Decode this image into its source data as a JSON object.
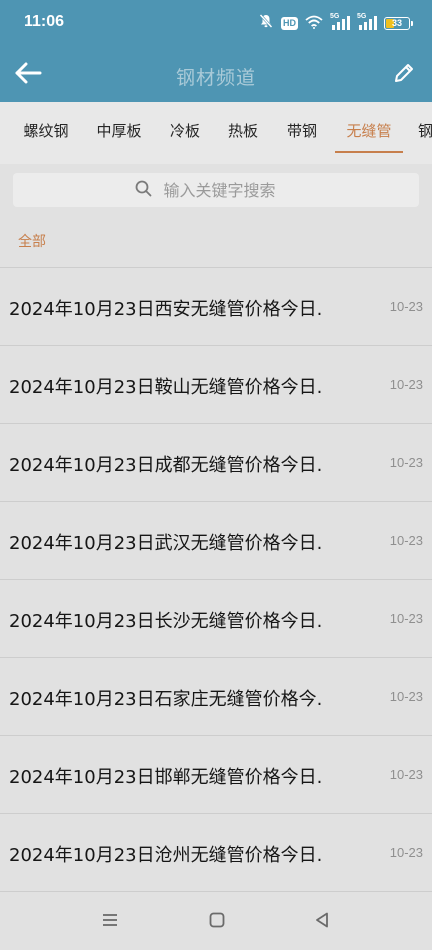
{
  "status_bar": {
    "time": "11:06",
    "hd_label": "HD",
    "battery_level": "33",
    "battery_fraction": 0.33,
    "icons": [
      "mute-bell-icon",
      "hd-icon",
      "wifi-icon",
      "5g-signal-icon",
      "5g-signal-icon",
      "battery-icon"
    ],
    "network_labels": [
      "5G",
      "5G"
    ]
  },
  "header": {
    "title": "钢材频道",
    "back_icon": "arrow-left-icon",
    "edit_icon": "pencil-icon"
  },
  "tabs": [
    {
      "label": "螺纹钢",
      "active": false
    },
    {
      "label": "中厚板",
      "active": false
    },
    {
      "label": "冷板",
      "active": false
    },
    {
      "label": "热板",
      "active": false
    },
    {
      "label": "带钢",
      "active": false
    },
    {
      "label": "无缝管",
      "active": true
    },
    {
      "label": "钢",
      "active": false
    }
  ],
  "search": {
    "placeholder": "输入关键字搜索",
    "icon": "search-icon"
  },
  "filter": {
    "label": "全部"
  },
  "news": [
    {
      "title": "2024年10月23日西安无缝管价格今日.",
      "date": "10-23"
    },
    {
      "title": "2024年10月23日鞍山无缝管价格今日.",
      "date": "10-23"
    },
    {
      "title": "2024年10月23日成都无缝管价格今日.",
      "date": "10-23"
    },
    {
      "title": "2024年10月23日武汉无缝管价格今日.",
      "date": "10-23"
    },
    {
      "title": "2024年10月23日长沙无缝管价格今日.",
      "date": "10-23"
    },
    {
      "title": "2024年10月23日石家庄无缝管价格今.",
      "date": "10-23"
    },
    {
      "title": "2024年10月23日邯郸无缝管价格今日.",
      "date": "10-23"
    },
    {
      "title": "2024年10月23日沧州无缝管价格今日.",
      "date": "10-23"
    }
  ],
  "nav_bar": {
    "icons": [
      "menu-icon",
      "home-square-icon",
      "back-triangle-icon"
    ]
  },
  "colors": {
    "header_bg": "#4e95b3",
    "accent": "#c77f4c",
    "page_bg": "#e1e1e1",
    "battery": "#f0c020"
  }
}
